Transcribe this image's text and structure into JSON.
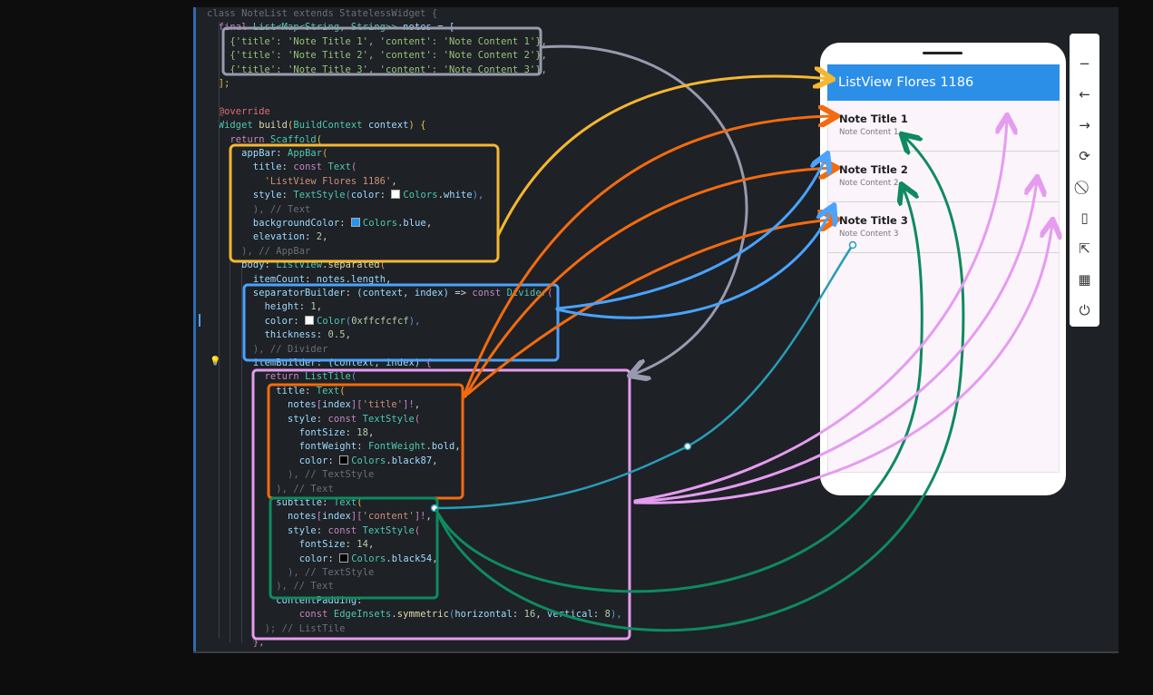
{
  "code": [
    [
      [
        "class NoteList extends StatelessWidget {",
        "c"
      ]
    ],
    [
      [
        "  final ",
        "k"
      ],
      [
        "List<Map<String, String>>",
        "t"
      ],
      [
        " notes = [",
        "p"
      ]
    ],
    [
      [
        "    {'title': 'Note Title 1', 'content': 'Note Content 1'},",
        "s2"
      ]
    ],
    [
      [
        "    {'title': 'Note Title 2', 'content': 'Note Content 2'},",
        "s2"
      ]
    ],
    [
      [
        "    {'title': 'Note Title 3', 'content': 'Note Content 3'},",
        "s2"
      ]
    ],
    [
      [
        "  ];",
        "kw"
      ]
    ],
    [
      [
        "",
        ""
      ]
    ],
    [
      [
        "  @override",
        "ann"
      ]
    ],
    [
      [
        "  ",
        ""
      ],
      [
        "Widget",
        "t"
      ],
      [
        " ",
        ""
      ],
      [
        "build",
        "f"
      ],
      [
        "(",
        "kw"
      ],
      [
        "BuildContext",
        "t"
      ],
      [
        " context",
        "p"
      ],
      [
        ") {",
        "kw"
      ]
    ],
    [
      [
        "    ",
        ""
      ],
      [
        "return",
        "k"
      ],
      [
        " ",
        ""
      ],
      [
        "Scaffold",
        "t"
      ],
      [
        "(",
        "kw"
      ]
    ],
    [
      [
        "      ",
        ""
      ],
      [
        "appBar",
        "p"
      ],
      [
        ": ",
        ""
      ],
      [
        "AppBar",
        "t"
      ],
      [
        "(",
        "or"
      ]
    ],
    [
      [
        "        ",
        ""
      ],
      [
        "title",
        "p"
      ],
      [
        ": ",
        ""
      ],
      [
        "const",
        "k"
      ],
      [
        " ",
        ""
      ],
      [
        "Text",
        "t"
      ],
      [
        "(",
        "k"
      ]
    ],
    [
      [
        "          ",
        ""
      ],
      [
        "'ListView Flores 1186'",
        "s"
      ],
      [
        ",",
        ""
      ]
    ],
    [
      [
        "        ",
        ""
      ],
      [
        "style",
        "p"
      ],
      [
        ": ",
        ""
      ],
      [
        "TextStyle",
        "t"
      ],
      [
        "(",
        "bl"
      ],
      [
        "color",
        "p"
      ],
      [
        ": ",
        ""
      ],
      [
        "#SWATCH:#ffffff",
        ""
      ],
      [
        "Colors",
        "t"
      ],
      [
        ".",
        ""
      ],
      [
        "white",
        "p"
      ],
      [
        "),",
        "bl"
      ]
    ],
    [
      [
        "        ",
        ""
      ],
      [
        "), // Text",
        "c"
      ]
    ],
    [
      [
        "        ",
        ""
      ],
      [
        "backgroundColor",
        "p"
      ],
      [
        ": ",
        ""
      ],
      [
        "#SWATCH:#2196f3",
        ""
      ],
      [
        "Colors",
        "t"
      ],
      [
        ".",
        ""
      ],
      [
        "blue",
        "p"
      ],
      [
        ",",
        ""
      ]
    ],
    [
      [
        "        ",
        ""
      ],
      [
        "elevation",
        "p"
      ],
      [
        ": ",
        ""
      ],
      [
        "2",
        "n"
      ],
      [
        ",",
        ""
      ]
    ],
    [
      [
        "      ",
        ""
      ],
      [
        "), // AppBar",
        "c"
      ]
    ],
    [
      [
        "      ",
        ""
      ],
      [
        "body",
        "p"
      ],
      [
        ": ",
        ""
      ],
      [
        "ListView",
        "t"
      ],
      [
        ".",
        ""
      ],
      [
        "separated",
        "f"
      ],
      [
        "(",
        "or"
      ]
    ],
    [
      [
        "        ",
        ""
      ],
      [
        "itemCount",
        "p"
      ],
      [
        ": ",
        ""
      ],
      [
        "notes",
        "p"
      ],
      [
        ".",
        ""
      ],
      [
        "length",
        "p"
      ],
      [
        ",",
        ""
      ]
    ],
    [
      [
        "        ",
        ""
      ],
      [
        "separatorBuilder",
        "p"
      ],
      [
        ": ",
        ""
      ],
      [
        "(context, index)",
        "p"
      ],
      [
        " => ",
        ""
      ],
      [
        "const",
        "k"
      ],
      [
        " ",
        ""
      ],
      [
        "Divider",
        "t"
      ],
      [
        "(",
        "k"
      ]
    ],
    [
      [
        "          ",
        ""
      ],
      [
        "height",
        "p"
      ],
      [
        ": ",
        ""
      ],
      [
        "1",
        "n"
      ],
      [
        ",",
        ""
      ]
    ],
    [
      [
        "          ",
        ""
      ],
      [
        "color",
        "p"
      ],
      [
        ": ",
        ""
      ],
      [
        "#SWATCH:#fcfcfc",
        ""
      ],
      [
        "Color",
        "t"
      ],
      [
        "(",
        "bl"
      ],
      [
        "0xffcfcfcf",
        "n"
      ],
      [
        "),",
        "bl"
      ]
    ],
    [
      [
        "          ",
        ""
      ],
      [
        "thickness",
        "p"
      ],
      [
        ": ",
        ""
      ],
      [
        "0.5",
        "n"
      ],
      [
        ",",
        ""
      ]
    ],
    [
      [
        "        ",
        ""
      ],
      [
        "), // Divider",
        "c"
      ]
    ],
    [
      [
        "        ",
        ""
      ],
      [
        "itemBuilder",
        "p"
      ],
      [
        ": ",
        ""
      ],
      [
        "(context, index)",
        "p"
      ],
      [
        " {",
        "k"
      ]
    ],
    [
      [
        "          ",
        ""
      ],
      [
        "return",
        "k"
      ],
      [
        " ",
        ""
      ],
      [
        "ListTile",
        "t"
      ],
      [
        "(",
        "bl"
      ]
    ],
    [
      [
        "            ",
        ""
      ],
      [
        "title",
        "p"
      ],
      [
        ": ",
        ""
      ],
      [
        "Text",
        "t"
      ],
      [
        "(",
        "kw"
      ]
    ],
    [
      [
        "              ",
        ""
      ],
      [
        "notes",
        "p"
      ],
      [
        "[",
        "k"
      ],
      [
        "index",
        "p"
      ],
      [
        "][",
        "k"
      ],
      [
        "'title'",
        "s"
      ],
      [
        "]!",
        "k"
      ],
      [
        ",",
        ""
      ]
    ],
    [
      [
        "              ",
        ""
      ],
      [
        "style",
        "p"
      ],
      [
        ": ",
        ""
      ],
      [
        "const",
        "k"
      ],
      [
        " ",
        ""
      ],
      [
        "TextStyle",
        "t"
      ],
      [
        "(",
        "k"
      ]
    ],
    [
      [
        "                ",
        ""
      ],
      [
        "fontSize",
        "p"
      ],
      [
        ": ",
        ""
      ],
      [
        "18",
        "n"
      ],
      [
        ",",
        ""
      ]
    ],
    [
      [
        "                ",
        ""
      ],
      [
        "fontWeight",
        "p"
      ],
      [
        ": ",
        ""
      ],
      [
        "FontWeight",
        "t"
      ],
      [
        ".",
        ""
      ],
      [
        "bold",
        "p"
      ],
      [
        ",",
        ""
      ]
    ],
    [
      [
        "                ",
        ""
      ],
      [
        "color",
        "p"
      ],
      [
        ": ",
        ""
      ],
      [
        "#SWATCH:#000000",
        ""
      ],
      [
        "Colors",
        "t"
      ],
      [
        ".",
        ""
      ],
      [
        "black87",
        "p"
      ],
      [
        ",",
        ""
      ]
    ],
    [
      [
        "              ",
        ""
      ],
      [
        "), // TextStyle",
        "c"
      ]
    ],
    [
      [
        "            ",
        ""
      ],
      [
        "), // Text",
        "c"
      ]
    ],
    [
      [
        "            ",
        ""
      ],
      [
        "subtitle",
        "p"
      ],
      [
        ": ",
        ""
      ],
      [
        "Text",
        "t"
      ],
      [
        "(",
        "kw"
      ]
    ],
    [
      [
        "              ",
        ""
      ],
      [
        "notes",
        "p"
      ],
      [
        "[",
        "k"
      ],
      [
        "index",
        "p"
      ],
      [
        "][",
        "k"
      ],
      [
        "'content'",
        "s"
      ],
      [
        "]!",
        "k"
      ],
      [
        ",",
        ""
      ]
    ],
    [
      [
        "              ",
        ""
      ],
      [
        "style",
        "p"
      ],
      [
        ": ",
        ""
      ],
      [
        "const",
        "k"
      ],
      [
        " ",
        ""
      ],
      [
        "TextStyle",
        "t"
      ],
      [
        "(",
        "k"
      ]
    ],
    [
      [
        "                ",
        ""
      ],
      [
        "fontSize",
        "p"
      ],
      [
        ": ",
        ""
      ],
      [
        "14",
        "n"
      ],
      [
        ",",
        ""
      ]
    ],
    [
      [
        "                ",
        ""
      ],
      [
        "color",
        "p"
      ],
      [
        ": ",
        ""
      ],
      [
        "#SWATCH:#000000",
        ""
      ],
      [
        "Colors",
        "t"
      ],
      [
        ".",
        ""
      ],
      [
        "black54",
        "p"
      ],
      [
        ",",
        ""
      ]
    ],
    [
      [
        "              ",
        ""
      ],
      [
        "), // TextStyle",
        "c"
      ]
    ],
    [
      [
        "            ",
        ""
      ],
      [
        "), // Text",
        "c"
      ]
    ],
    [
      [
        "            ",
        ""
      ],
      [
        "contentPadding",
        "p"
      ],
      [
        ":",
        ""
      ]
    ],
    [
      [
        "                ",
        ""
      ],
      [
        "const",
        "k"
      ],
      [
        " ",
        ""
      ],
      [
        "EdgeInsets",
        "t"
      ],
      [
        ".",
        ""
      ],
      [
        "symmetric",
        "f"
      ],
      [
        "(",
        "bl"
      ],
      [
        "horizontal",
        "p"
      ],
      [
        ": ",
        ""
      ],
      [
        "16",
        "n"
      ],
      [
        ", ",
        ""
      ],
      [
        "vertical",
        "p"
      ],
      [
        ": ",
        ""
      ],
      [
        "8",
        "n"
      ],
      [
        "),",
        "bl"
      ]
    ],
    [
      [
        "          ",
        ""
      ],
      [
        "); // ListTile",
        "c"
      ]
    ],
    [
      [
        "        ",
        ""
      ],
      [
        "},",
        "k"
      ]
    ]
  ],
  "phone": {
    "appbar_title": "ListView Flores 1186",
    "tiles": [
      {
        "title": "Note Title 1",
        "subtitle": "Note Content 1"
      },
      {
        "title": "Note Title 2",
        "subtitle": "Note Content 2"
      },
      {
        "title": "Note Title 3",
        "subtitle": "Note Content 3"
      }
    ]
  },
  "toolbar": [
    {
      "name": "minimize-icon",
      "glyph": "−"
    },
    {
      "name": "back-arrow-icon",
      "glyph": "←"
    },
    {
      "name": "forward-arrow-icon",
      "glyph": "→"
    },
    {
      "name": "rotate-icon",
      "glyph": "⟳"
    },
    {
      "name": "rotate-device-icon",
      "glyph": "⃠"
    },
    {
      "name": "phone-fold-icon",
      "glyph": "▯"
    },
    {
      "name": "open-external-icon",
      "glyph": "⇱"
    },
    {
      "name": "qr-code-icon",
      "glyph": "▦"
    },
    {
      "name": "power-icon",
      "glyph": "⏻"
    }
  ],
  "colors": {
    "notes_box": "#9a9aae",
    "appbar_box": "#f5b731",
    "separator_box": "#4aa3ff",
    "listtile_box": "#e59cf0",
    "title_box": "#f26b10",
    "subtitle_box": "#0f8a5f",
    "appbar": "#2b8fe8"
  }
}
